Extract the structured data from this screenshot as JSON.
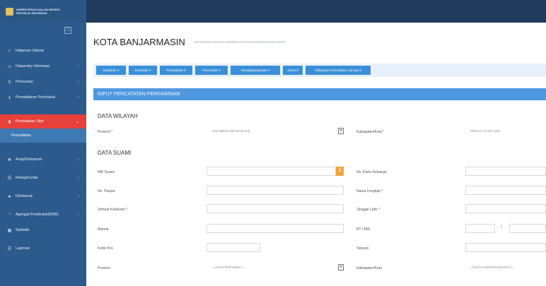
{
  "brand": {
    "line1": "KEMENTERIAN DALAM NEGERI",
    "line2": "REPUBLIK INDONESIA"
  },
  "sidebar": {
    "items": [
      {
        "label": "Halaman Utama",
        "icon": "home-icon"
      },
      {
        "label": "Dataentry Informasi",
        "icon": "monitor-icon"
      },
      {
        "label": "Pencarian",
        "icon": "search-icon"
      },
      {
        "label": "Pendaftaran Penduduk",
        "icon": "info-icon"
      },
      {
        "label": "Pencatatan Sipil",
        "icon": "book-icon"
      },
      {
        "label": "Pencatatan",
        "icon": ""
      },
      {
        "label": "Arsip/Dokumen",
        "icon": "tag-icon"
      },
      {
        "label": "Rekap/Cetak",
        "icon": "printer-icon"
      },
      {
        "label": "Direktorat",
        "icon": "star-icon"
      },
      {
        "label": "Agregat Penduduk(DKB)",
        "icon": "pie-chart-icon"
      },
      {
        "label": "Statistik",
        "icon": "table-icon"
      },
      {
        "label": "Laporan",
        "icon": "list-icon"
      }
    ]
  },
  "header": {
    "title": "KOTA BANJARMASIN",
    "subtitle": "SISTEM INFORMASI ADMINISTRASI KEPENDUDUKAN (SIAK)"
  },
  "menubar": {
    "items": [
      "Kelahiran",
      "Kematian",
      "Perkawinan",
      "Perceraian",
      "Kewarganegaraan",
      "Akses",
      "Pelaporan Pencatatan Lainnya"
    ]
  },
  "form": {
    "section_title": "INPUT PENCATATAN PERKAWINAN",
    "wilayah": {
      "heading": "DATA WILAYAH",
      "provinsi_label": "Provinsi *",
      "provinsi_value": "SULAWESI SELATAN (73)",
      "kabupaten_label": "Kabupaten/Kota *",
      "kabupaten_value": "TORAJA UTARA (26)"
    },
    "suami": {
      "heading": "DATA SUAMI",
      "nik_label": "NIK Suami",
      "no_kk_label": "No. Kartu Keluarga",
      "no_paspor_label": "No. Paspor",
      "nama_label": "Nama Lengkap *",
      "tempat_lahir_label": "Tempat Kelahiran *",
      "tanggal_lahir_label": "Tanggal Lahir *",
      "alamat_label": "Alamat",
      "rt_rw_label": "RT / RW",
      "rt_sep": "/",
      "kode_pos_label": "Kode Pos",
      "telepon_label": "Telepon",
      "provinsi_label": "Provinsi",
      "provinsi_placeholder": "==PILIH PROVINSI==",
      "kabupaten_label": "Kabupaten/Kota",
      "kabupaten_placeholder": "==PILIH KABUPATEN/KOTA=="
    }
  }
}
